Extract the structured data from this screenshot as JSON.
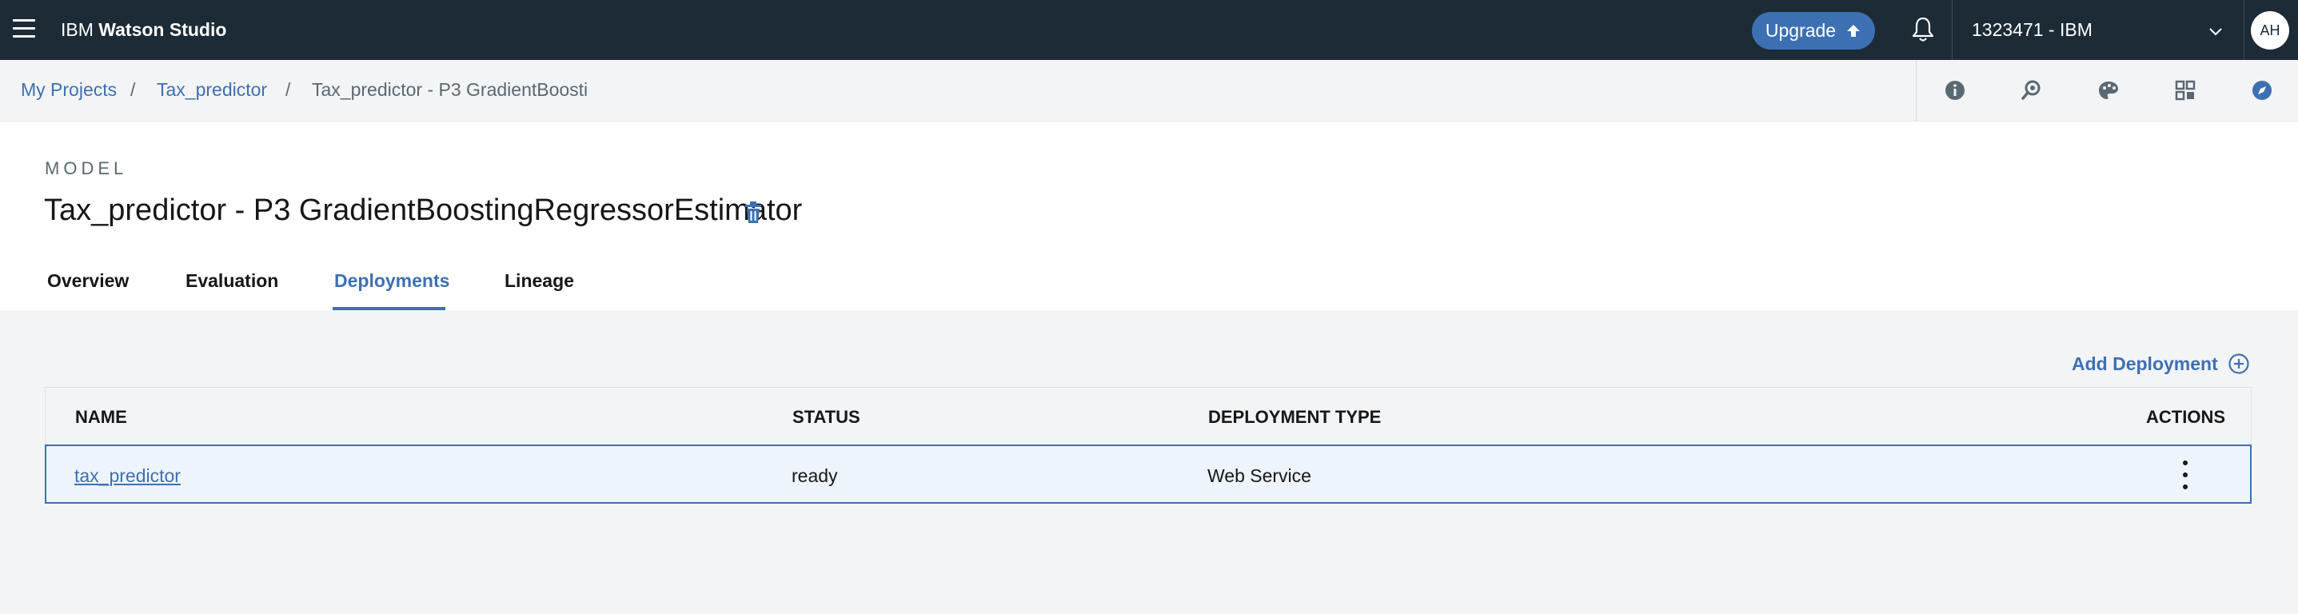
{
  "topbar": {
    "brand_prefix": "IBM",
    "brand_name": "Watson Studio",
    "upgrade_label": "Upgrade",
    "account": "1323471 - IBM",
    "avatar_initials": "AH"
  },
  "breadcrumb": {
    "items": [
      "My Projects",
      "Tax_predictor",
      "Tax_predictor - P3 GradientBoosti"
    ],
    "separator": "/"
  },
  "toolbar": {
    "icons": [
      "info-icon",
      "search-settings-icon",
      "palette-icon",
      "apps-grid-icon",
      "compass-icon"
    ]
  },
  "model": {
    "eyebrow": "MODEL",
    "title": "Tax_predictor - P3 GradientBoostingRegressorEstimator"
  },
  "tabs": [
    {
      "label": "Overview",
      "active": false
    },
    {
      "label": "Evaluation",
      "active": false
    },
    {
      "label": "Deployments",
      "active": true
    },
    {
      "label": "Lineage",
      "active": false
    }
  ],
  "deployments": {
    "add_label": "Add Deployment",
    "columns": [
      "NAME",
      "STATUS",
      "DEPLOYMENT TYPE",
      "ACTIONS"
    ],
    "rows": [
      {
        "name": "tax_predictor",
        "status": "ready",
        "type": "Web Service"
      }
    ]
  },
  "colors": {
    "topbar": "#1c2b36",
    "accent": "#3d70b2",
    "page_bg": "#f3f4f6"
  }
}
